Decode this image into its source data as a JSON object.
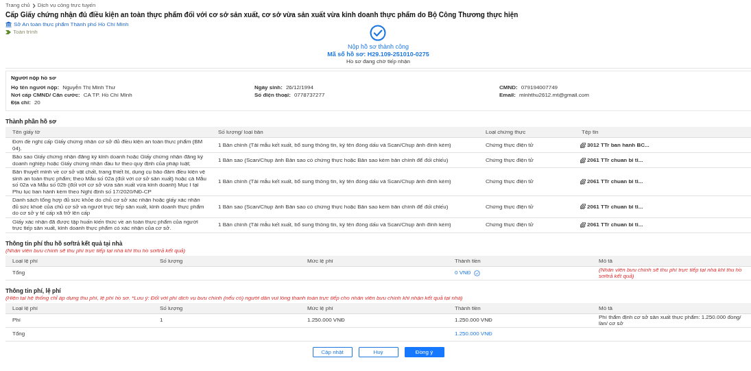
{
  "breadcrumb": [
    {
      "label": "Trang chủ"
    },
    {
      "label": "Dịch vụ công trực tuyến"
    }
  ],
  "title": "Cấp Giấy chứng nhận đủ điều kiện an toàn thực phẩm đối với cơ sở sản xuất, cơ sở vừa sản xuất vừa kinh doanh thực phẩm do Bộ Công Thương thực hiện",
  "agency": "Sở An toàn thực phẩm Thành phố Hồ Chí Minh",
  "service_level": "Toàn trình",
  "result": {
    "title": "Nộp hồ sơ thành công",
    "code": "Mã số hồ sơ: H29.109-251010-0275",
    "status": "Hồ sơ đang chờ tiếp nhận"
  },
  "applicant": {
    "heading": "Người nộp hồ sơ",
    "fields": [
      {
        "label": "Họ tên người nộp:",
        "value": "Nguyễn Thị Minh Thư"
      },
      {
        "label": "Ngày sinh:",
        "value": "26/12/1994"
      },
      {
        "label": "CMND:",
        "value": "079194007749"
      },
      {
        "label": "Nơi cấp CMND/ Căn cước:",
        "value": "CA TP. Hồ Chí Minh"
      },
      {
        "label": "Số điện thoại:",
        "value": "0778737277"
      },
      {
        "label": "Email:",
        "value": "minhthu2612.mt@gmail.com"
      },
      {
        "label": "Địa chỉ:",
        "value": "20"
      }
    ]
  },
  "documents": {
    "heading": "Thành phần hồ sơ",
    "columns": [
      "Tên giấy tờ",
      "Số lượng/ loại bản",
      "Loại chứng thực",
      "Tệp tin"
    ],
    "rows": [
      {
        "name": "Đơn đề nghị cấp Giấy chứng nhận cơ sở đủ điều kiện an toàn thực phẩm (BM 04).",
        "copy": "1 Bản chính (Tải mẫu kết xuất, bổ sung thông tin, ký tên đóng dấu và Scan/Chụp ảnh đính kèm)",
        "certification": "Chứng thực điện tử",
        "file": "3012 TTr ban hanh BC..."
      },
      {
        "name": "Bảo sao Giấy chứng nhận đăng ký kinh doanh hoặc Giấy chứng nhận đăng ký doanh nghiệp hoặc Giấy chứng nhận đầu tư theo quy định của pháp luật;",
        "copy": "1 Bản sao (Scan/Chụp ảnh Bản sao có chứng thực hoặc Bản sao kèm bản chính để đối chiếu)",
        "certification": "Chứng thực điện tử",
        "file": "2061 TTr chuan bi ti..."
      },
      {
        "name": "Bản thuyết minh về cơ sở vật chất, trang thiết bị, dụng cụ bảo đảm điều kiện vệ sinh an toàn thực phẩm; theo Mẫu số 02a (đối với cơ sở sản xuất) hoặc cả Mẫu số 02a và Mẫu số 02b (đối với cơ sở vừa sản xuất vừa kinh doanh) Mục I tại Phụ lục ban hành kèm theo Nghị định số 17/2020/NĐ-CP",
        "copy": "1 Bản chính (Tải mẫu kết xuất, bổ sung thông tin, ký tên đóng dấu và Scan/Chụp ảnh đính kèm)",
        "certification": "Chứng thực điện tử",
        "file": "2061 TTr chuan bi ti..."
      },
      {
        "name": "Danh sách tổng hợp đủ sức khỏe do chủ cơ sở xác nhận hoặc giấy xác nhận đủ sức khoẻ của chủ cơ sở và người trực tiếp sản xuất, kinh doanh thực phẩm do cơ sở y tế cấp xã trở lên cấp",
        "copy": "1 Bản sao (Scan/Chụp ảnh Bản sao có chứng thực hoặc Bản sao kèm bản chính để đối chiếu)",
        "certification": "Chứng thực điện tử",
        "file": "2061 TTr chuan bi ti..."
      },
      {
        "name": "Giấy xác nhận đã được tập huấn kiến thức về an toàn thực phẩm của người trực tiếp sản xuất, kinh doanh thực phẩm có xác nhận của cơ sở.",
        "copy": "1 Bản chính (Tải mẫu kết xuất, bổ sung thông tin, ký tên đóng dấu và Scan/Chụp ảnh đính kèm)",
        "certification": "Chứng thực điện tử",
        "file": "2061 TTr chuan bi ti..."
      }
    ]
  },
  "fee_tables": [
    {
      "heading": "Thông tin phí thu hồ sơ/trả kết quả tại nhà",
      "note": "(Nhân viên bưu chính sẽ thu phí trực tiếp tại nhà khi thu hồ sơ/trả kết quả)",
      "columns": [
        "Loại lệ phí",
        "Số lượng",
        "Mức lệ phí",
        "Thành tiền",
        "Mô tả"
      ],
      "rows": [
        {
          "kind": "total",
          "verified": true,
          "cells": [
            "Tổng",
            "",
            "",
            "0 VNĐ",
            "(Nhân viên bưu chính sẽ thu phí trực tiếp tại nhà khi thu hồ sơ/trả kết quả)"
          ]
        }
      ]
    },
    {
      "heading": "Thông tin phí, lệ phí",
      "note": "(Hiện tại hệ thống chỉ áp dụng thu phí, lệ phí hồ sơ. *Lưu ý: Đối với phí dịch vụ bưu chính (nếu có) người dân vui lòng thanh toán trực tiếp cho nhân viên bưu chính khi nhận kết quả tại nhà)",
      "columns": [
        "Loại lệ phí",
        "Số lượng",
        "Mức lệ phí",
        "Thành tiền",
        "Mô tả"
      ],
      "rows": [
        {
          "kind": "item",
          "verified": false,
          "cells": [
            "Phí",
            "1",
            "1.250.000 VNĐ",
            "1.250.000 VNĐ",
            "Phí thẩm định cơ sở sản xuất thực phẩm: 1.250.000 đồng/ lần/ cơ sở"
          ]
        },
        {
          "kind": "total",
          "verified": false,
          "cells": [
            "Tổng",
            "",
            "",
            "1.250.000 VNĐ",
            ""
          ]
        }
      ]
    }
  ],
  "buttons": [
    {
      "label": "Cập nhật",
      "kind": "outline"
    },
    {
      "label": "Huỷ",
      "kind": "outline"
    },
    {
      "label": "Đồng ý",
      "kind": "primary"
    }
  ]
}
